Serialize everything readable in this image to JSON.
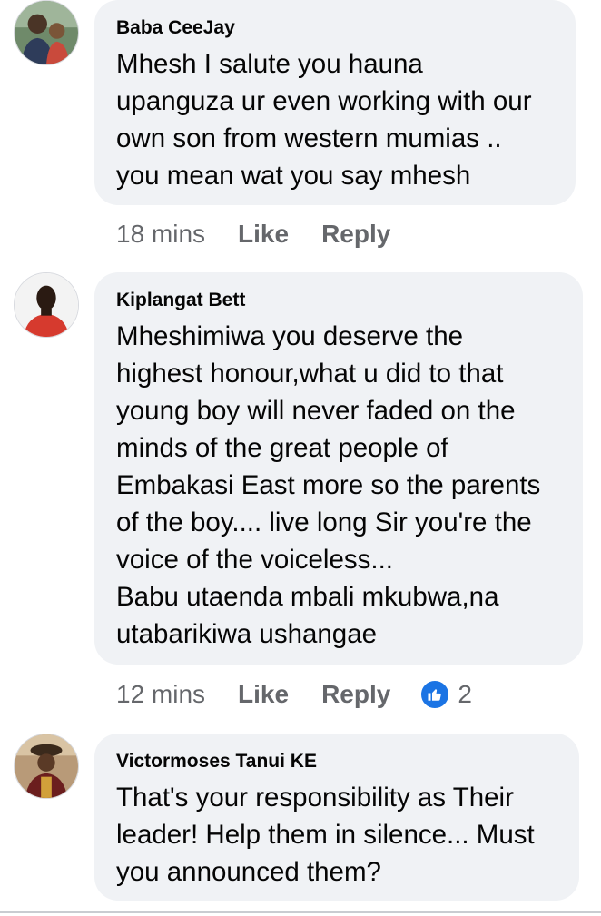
{
  "comments": [
    {
      "author": "Baba CeeJay",
      "avatar_icon": "profile-photo-man-with-child",
      "text": "Mhesh I salute you hauna\nupanguza ur even working with our\nown son from western mumias ..\nyou mean wat you say mhesh",
      "time": "18 mins",
      "like_label": "Like",
      "reply_label": "Reply",
      "reactions": null
    },
    {
      "author": "Kiplangat Bett",
      "avatar_icon": "profile-photo-man-red-shirt",
      "text": "Mheshimiwa you deserve the\nhighest honour,what u did to that\nyoung boy will never faded on the\nminds of the great people of\nEmbakasi East more so the parents\nof the boy.... live long Sir you're the\nvoice of the voiceless...\nBabu utaenda mbali mkubwa,na\nutabarikiwa ushangae",
      "time": "12 mins",
      "like_label": "Like",
      "reply_label": "Reply",
      "reactions": "2"
    },
    {
      "author": "Victormoses Tanui KE",
      "avatar_icon": "profile-photo-person-with-hat",
      "text": "That's your responsibility as Their\nleader! Help them in silence... Must\nyou announced them?",
      "time": null,
      "like_label": null,
      "reply_label": null,
      "reactions": null
    }
  ],
  "colors": {
    "bubble_bg": "#f0f2f5",
    "text": "#050505",
    "secondary_text": "#65676b",
    "like_blue": "#1b74e4"
  }
}
